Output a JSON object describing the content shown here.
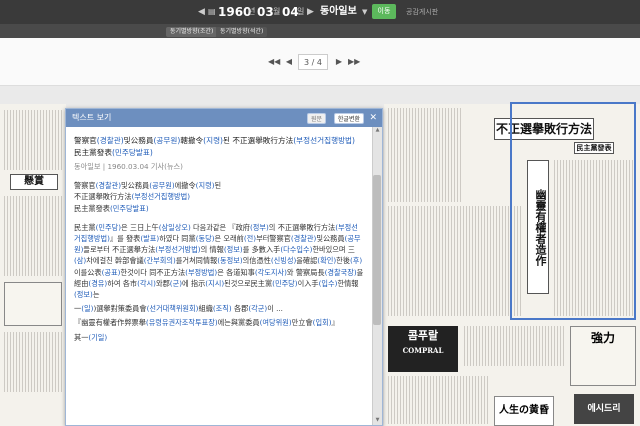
{
  "topbar": {
    "prev_year": "◀",
    "year": "1960",
    "month": "03",
    "day": "04",
    "sep_year": "년",
    "sep_month": "월",
    "sep_day": "일",
    "next": "▶",
    "paper": "동아일보",
    "paper_arrow": "▼",
    "go": "이동",
    "board": "공감게시판"
  },
  "subtabs": {
    "tab1": "동기별방향(조간)",
    "tab2": "동기별방향(석간)"
  },
  "pager": {
    "first": "◀◀",
    "prev": "◀",
    "current": "3",
    "slash": "/",
    "total": "4",
    "next": "▶",
    "last": "▶▶"
  },
  "panel": {
    "title": "텍스트 보기",
    "btn_original": "원문",
    "btn_hangul": "한글변환",
    "close": "✕",
    "headline": "警察官(경찰관)및公務員(공무원)轄撤令(지령)된  不正選擧敗行方法(부정선거집행방법) 民主黨發表(민주당발표)",
    "meta": "동아일보 | 1960.03.04  기사(뉴스)",
    "lines": [
      "警察官(경찰관)및公務員(공무원)에撤令(지령)된",
      "不正選擧敗行方法(부정선거집행방법)",
      "民主黨發表(민주당발표)",
      "民主黨(민주당)은 三日上午(삼일상오) 다음과같은 『政府(정부)의 不正選擧敗行方法(부정선거집행방법)』를 發表(발표)하였다 同黨(동당)은 오래前(전)부터警察官(경찰관)및公務員(공무원)들로부터 不正選擧方法(부정선거방법)의 情報(정보)를 多數入手(다수입수)한바있으며 三(삼)차에걸친 幹部會議(간부회의)를거쳐同情報(동정보)의信憑性(신빙성)을確認(확인)한後(후) 이를公表(공표)한것이다 同不正方法(부정방법)은 各道知事(각도지사)와 警察局長(경찰국장)을經由(경유)하여 各市(각시)와郡(군)에 指示(지시)된것으로民主黨(민주당)이入手(입수)한情報(정보)는",
      "一(일))選擧對策委員會(선거대책위원회)組織(조직) 各郡(각군)이 ...",
      "『幽靈有權者作弊票擧(유령유권자조작투표장)에는與黨委員(여당위원)만立會(입회)』",
      "其一(기일)"
    ]
  },
  "newspaper": {
    "right_headline": "不正選擧敗行方法",
    "right_sub": "民主黨發表",
    "vert_headline": "幽靈有權者造作",
    "left_headline": "懸賞",
    "ad1": "콤푸랄",
    "ad1_sub": "COMPRAL",
    "ad2": "強力",
    "ad3": "人生の黄昏",
    "ad4": "에시드리"
  }
}
